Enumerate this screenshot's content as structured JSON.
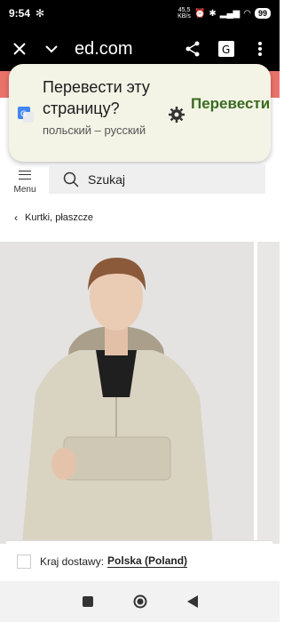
{
  "status_bar": {
    "time": "9:54",
    "net_speed_value": "45,5",
    "net_speed_unit": "KB/s",
    "battery": "99"
  },
  "browser": {
    "url": "ed.com"
  },
  "translate_popup": {
    "title": "Перевести эту страницу?",
    "subtitle": "польский – русский",
    "action_label": "Перевести"
  },
  "header": {
    "menu_label": "Menu",
    "search_placeholder": "Szukaj"
  },
  "breadcrumb": {
    "label": "Kurtki, płaszcze"
  },
  "delivery": {
    "label": "Kraj dostawy:",
    "value": "Polska (Poland)"
  },
  "colors": {
    "promo_strip": "#e9726a",
    "popup_bg": "#f3f4e6",
    "translate_action": "#3a6b20"
  },
  "icons": [
    "close-icon",
    "chevron-down-icon",
    "share-icon",
    "translate-icon",
    "more-vert-icon",
    "google-translate-icon",
    "gear-icon",
    "search-icon",
    "back-chevron-icon",
    "nav-square-icon",
    "nav-circle-icon",
    "nav-back-icon"
  ]
}
